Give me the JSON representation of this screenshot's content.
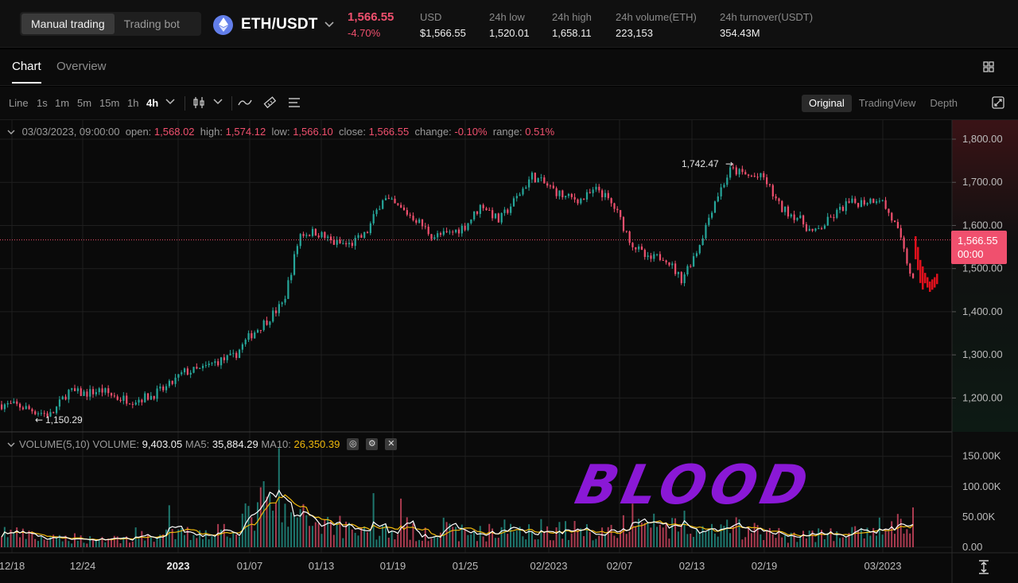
{
  "header": {
    "mode_tabs": [
      "Manual trading",
      "Trading bot"
    ],
    "pair": "ETH/USDT",
    "last_price": "1,566.55",
    "change_pct": "-4.70%",
    "stats": [
      {
        "label": "USD",
        "value": "$1,566.55"
      },
      {
        "label": "24h low",
        "value": "1,520.01"
      },
      {
        "label": "24h high",
        "value": "1,658.11"
      },
      {
        "label": "24h volume(ETH)",
        "value": "223,153"
      },
      {
        "label": "24h turnover(USDT)",
        "value": "354.43M"
      }
    ]
  },
  "tabs": [
    "Chart",
    "Overview"
  ],
  "toolbar": {
    "intervals": [
      "Line",
      "1s",
      "1m",
      "5m",
      "15m",
      "1h",
      "4h"
    ],
    "active_interval": "4h",
    "views": [
      "Original",
      "TradingView",
      "Depth"
    ],
    "active_view": "Original"
  },
  "ohlc": {
    "date": "03/03/2023, 09:00:00",
    "open_label": "open:",
    "open": "1,568.02",
    "high_label": "high:",
    "high": "1,574.12",
    "low_label": "low:",
    "low": "1,566.10",
    "close_label": "close:",
    "close": "1,566.55",
    "change_label": "change:",
    "change": "-0.10%",
    "range_label": "range:",
    "range": "0.51%"
  },
  "volume_info": {
    "title": "VOLUME(5,10)",
    "volume_label": "VOLUME:",
    "volume": "9,403.05",
    "ma5_label": "MA5:",
    "ma5": "35,884.29",
    "ma10_label": "MA10:",
    "ma10": "26,350.39"
  },
  "price_tag": {
    "price": "1,566.55",
    "countdown": "00:00"
  },
  "annotations": {
    "high": "1,742.47",
    "low": "1,150.29"
  },
  "overlay_text": "BLOOD",
  "colors": {
    "up": "#26a69a",
    "down": "#f0506e",
    "accent": "#8a18d6",
    "ma5": "#ffffff",
    "ma10": "#f0b90b"
  },
  "chart_data": {
    "type": "candlestick",
    "price_axis": {
      "ticks": [
        "1,800.00",
        "1,700.00",
        "1,600.00",
        "1,500.00",
        "1,400.00",
        "1,300.00",
        "1,200.00"
      ],
      "values": [
        1800,
        1700,
        1600,
        1500,
        1400,
        1300,
        1200
      ]
    },
    "volume_axis": {
      "ticks": [
        "150.00K",
        "100.00K",
        "50.00K",
        "0.00"
      ],
      "values": [
        150000,
        100000,
        50000,
        0
      ]
    },
    "x_ticks": [
      "12/18",
      "12/24",
      "2023",
      "01/07",
      "01/13",
      "01/19",
      "01/25",
      "02/2023",
      "02/07",
      "02/13",
      "02/19",
      "03/2023"
    ],
    "price_trend": [
      1185,
      1182,
      1170,
      1160,
      1215,
      1210,
      1218,
      1200,
      1195,
      1205,
      1225,
      1260,
      1265,
      1285,
      1295,
      1345,
      1380,
      1420,
      1580,
      1585,
      1560,
      1555,
      1580,
      1665,
      1640,
      1615,
      1575,
      1580,
      1600,
      1650,
      1610,
      1660,
      1715,
      1690,
      1665,
      1660,
      1685,
      1640,
      1560,
      1520,
      1530,
      1475,
      1545,
      1655,
      1730,
      1715,
      1710,
      1640,
      1620,
      1580,
      1615,
      1650,
      1655,
      1665,
      1595,
      1470
    ],
    "volume_pattern": [
      25000,
      20000,
      15000,
      12000,
      15000,
      13000,
      14000,
      13000,
      16000,
      18000,
      20000,
      22000,
      25000,
      30000,
      45000,
      70000,
      50000,
      45000,
      40000,
      38000,
      30000,
      28000,
      25000,
      22000,
      25000,
      26000,
      24000,
      22000,
      24000,
      30000,
      30000,
      28000,
      27000,
      26000,
      25000,
      28000,
      35000,
      40000,
      30000,
      26000,
      22000,
      24000,
      32000,
      25000,
      20000,
      18000,
      20000,
      20000,
      18000,
      22000,
      30000,
      35000,
      40000
    ],
    "current_price": 1566.55,
    "high_marker": 1742.47,
    "low_marker": 1150.29
  }
}
